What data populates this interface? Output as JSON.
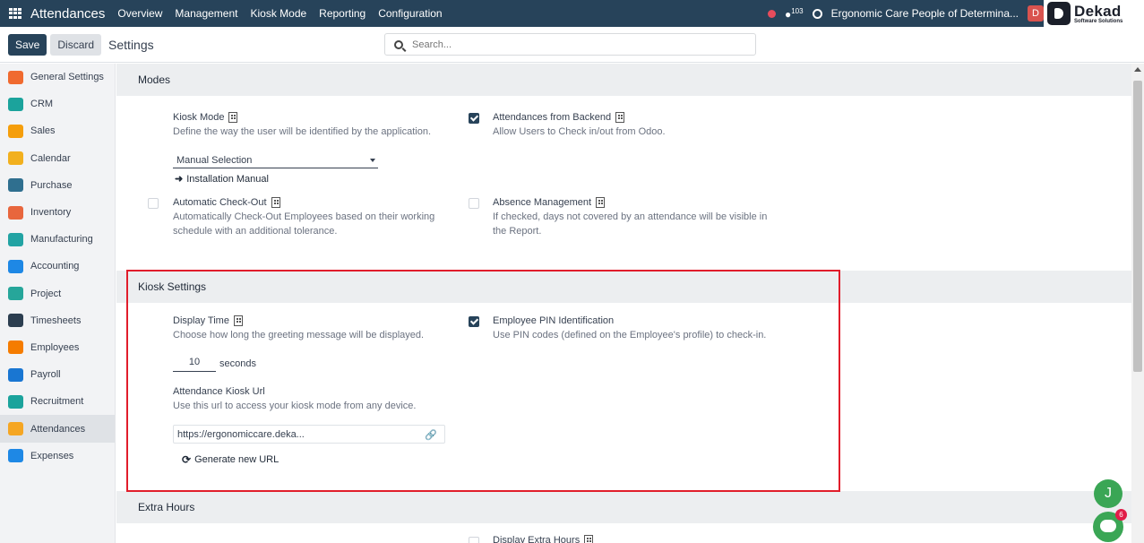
{
  "topbar": {
    "app_name": "Attendances",
    "menu": [
      "Overview",
      "Management",
      "Kiosk Mode",
      "Reporting",
      "Configuration"
    ],
    "chat_count": "103",
    "company": "Ergonomic Care People of Determina...",
    "avatar_letter": "D",
    "brand_name": "Dekad",
    "brand_sub": "Software Solutions"
  },
  "control": {
    "save_label": "Save",
    "discard_label": "Discard",
    "title": "Settings",
    "search_placeholder": "Search..."
  },
  "sidebar": {
    "items": [
      {
        "label": "General Settings",
        "color": "#f06a2f"
      },
      {
        "label": "CRM",
        "color": "#1ba39c"
      },
      {
        "label": "Sales",
        "color": "#f59e0b"
      },
      {
        "label": "Calendar",
        "color": "#f2b01e"
      },
      {
        "label": "Purchase",
        "color": "#2f6f8f"
      },
      {
        "label": "Inventory",
        "color": "#e8663d"
      },
      {
        "label": "Manufacturing",
        "color": "#22a3a3"
      },
      {
        "label": "Accounting",
        "color": "#1e88e5"
      },
      {
        "label": "Project",
        "color": "#26a69a"
      },
      {
        "label": "Timesheets",
        "color": "#2c3e50"
      },
      {
        "label": "Employees",
        "color": "#f57c00"
      },
      {
        "label": "Payroll",
        "color": "#1976d2"
      },
      {
        "label": "Recruitment",
        "color": "#1ba39c"
      },
      {
        "label": "Attendances",
        "color": "#f5a623"
      },
      {
        "label": "Expenses",
        "color": "#1e88e5"
      }
    ],
    "active": "Attendances"
  },
  "modes": {
    "heading": "Modes",
    "kiosk_mode": {
      "title": "Kiosk Mode",
      "desc": "Define the way the user will be identified by the application.",
      "selected": "Manual Selection",
      "link": "Installation Manual"
    },
    "backend": {
      "title": "Attendances from Backend",
      "desc": "Allow Users to Check in/out from Odoo.",
      "checked": true
    },
    "auto_checkout": {
      "title": "Automatic Check-Out",
      "desc_line1": "Automatically Check-Out Employees based on their working",
      "desc_line2": "schedule with an additional tolerance.",
      "checked": false
    },
    "absence": {
      "title": "Absence Management",
      "desc_line1": "If checked, days not covered by an attendance will be visible in",
      "desc_line2": "the Report.",
      "checked": false
    }
  },
  "kiosk_settings": {
    "heading": "Kiosk Settings",
    "display_time": {
      "title": "Display Time",
      "desc": "Choose how long the greeting message will be displayed.",
      "value": "10",
      "unit": "seconds"
    },
    "pin": {
      "title": "Employee PIN Identification",
      "desc": "Use PIN codes (defined on the Employee's profile) to check-in.",
      "checked": true
    },
    "kiosk_url": {
      "title": "Attendance Kiosk Url",
      "desc": "Use this url to access your kiosk mode from any device.",
      "value": "https://ergonomiccare.deka...",
      "generate_label": "Generate new URL"
    }
  },
  "extra_hours": {
    "heading": "Extra Hours",
    "display_title": "Display Extra Hours"
  },
  "floating": {
    "user_letter": "J",
    "bot_badge": "6"
  }
}
